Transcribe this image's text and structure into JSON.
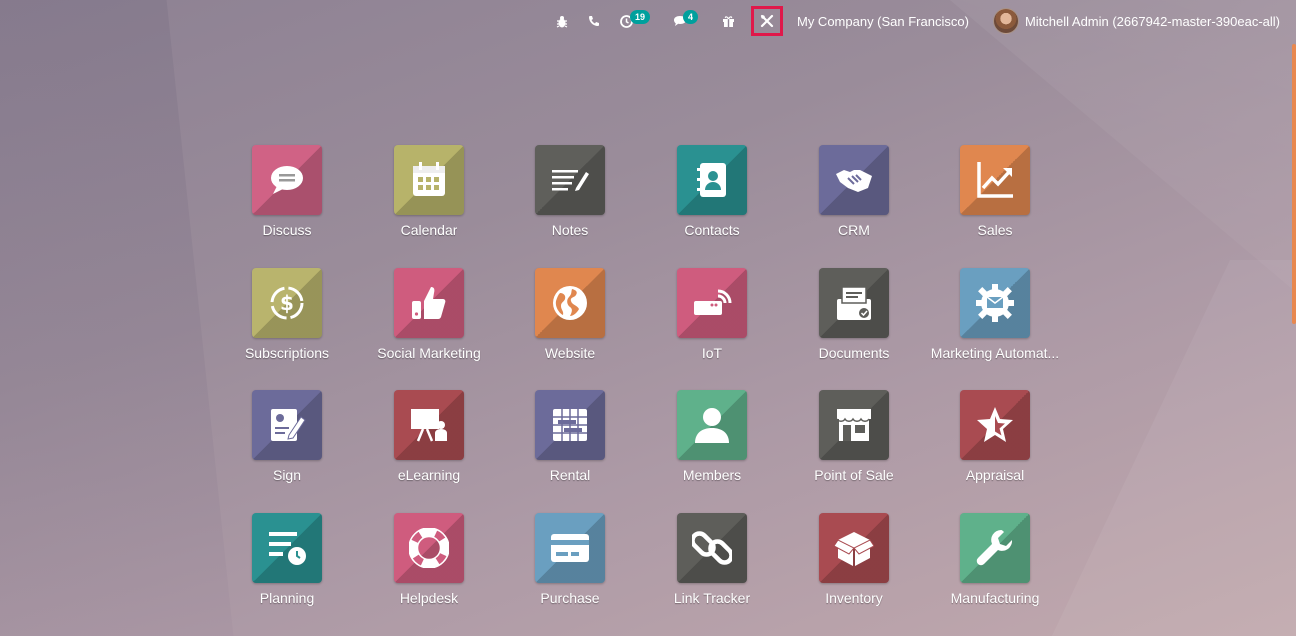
{
  "topbar": {
    "activity_count": "19",
    "messages_count": "4",
    "company": "My Company (San Francisco)",
    "user": "Mitchell Admin (2667942-master-390eac-all)"
  },
  "apps": [
    {
      "label": "Discuss",
      "color": "#d06285",
      "icon": "chat-bubble-icon"
    },
    {
      "label": "Calendar",
      "color": "#b7b36a",
      "icon": "calendar-icon"
    },
    {
      "label": "Notes",
      "color": "#5f5f5b",
      "icon": "notes-icon"
    },
    {
      "label": "Contacts",
      "color": "#2a9191",
      "icon": "contacts-book-icon"
    },
    {
      "label": "CRM",
      "color": "#6c6b9a",
      "icon": "handshake-icon"
    },
    {
      "label": "Sales",
      "color": "#e0874f",
      "icon": "trend-chart-icon"
    },
    {
      "label": "Subscriptions",
      "color": "#b9b46d",
      "icon": "recurring-dollar-icon"
    },
    {
      "label": "Social Marketing",
      "color": "#cf5c7e",
      "icon": "thumbs-up-icon"
    },
    {
      "label": "Website",
      "color": "#e0874f",
      "icon": "globe-icon"
    },
    {
      "label": "IoT",
      "color": "#cf5c7e",
      "icon": "iot-device-icon"
    },
    {
      "label": "Documents",
      "color": "#5e5e5a",
      "icon": "document-tray-icon"
    },
    {
      "label": "Marketing Automat...",
      "color": "#6a9fc0",
      "icon": "gear-mail-icon"
    },
    {
      "label": "Sign",
      "color": "#6c6b9a",
      "icon": "sign-pen-icon"
    },
    {
      "label": "eLearning",
      "color": "#a94b51",
      "icon": "presentation-icon"
    },
    {
      "label": "Rental",
      "color": "#6c6b9a",
      "icon": "rental-calendar-icon"
    },
    {
      "label": "Members",
      "color": "#5fb18b",
      "icon": "person-icon"
    },
    {
      "label": "Point of Sale",
      "color": "#5e5e5a",
      "icon": "store-icon"
    },
    {
      "label": "Appraisal",
      "color": "#a94b51",
      "icon": "star-icon"
    },
    {
      "label": "Planning",
      "color": "#2a9191",
      "icon": "planning-icon"
    },
    {
      "label": "Helpdesk",
      "color": "#cf5c7e",
      "icon": "lifebuoy-icon"
    },
    {
      "label": "Purchase",
      "color": "#6a9fc0",
      "icon": "credit-card-icon"
    },
    {
      "label": "Link Tracker",
      "color": "#5e5e5a",
      "icon": "chain-link-icon"
    },
    {
      "label": "Inventory",
      "color": "#a94b51",
      "icon": "box-icon"
    },
    {
      "label": "Manufacturing",
      "color": "#5fb18b",
      "icon": "wrench-icon"
    }
  ]
}
